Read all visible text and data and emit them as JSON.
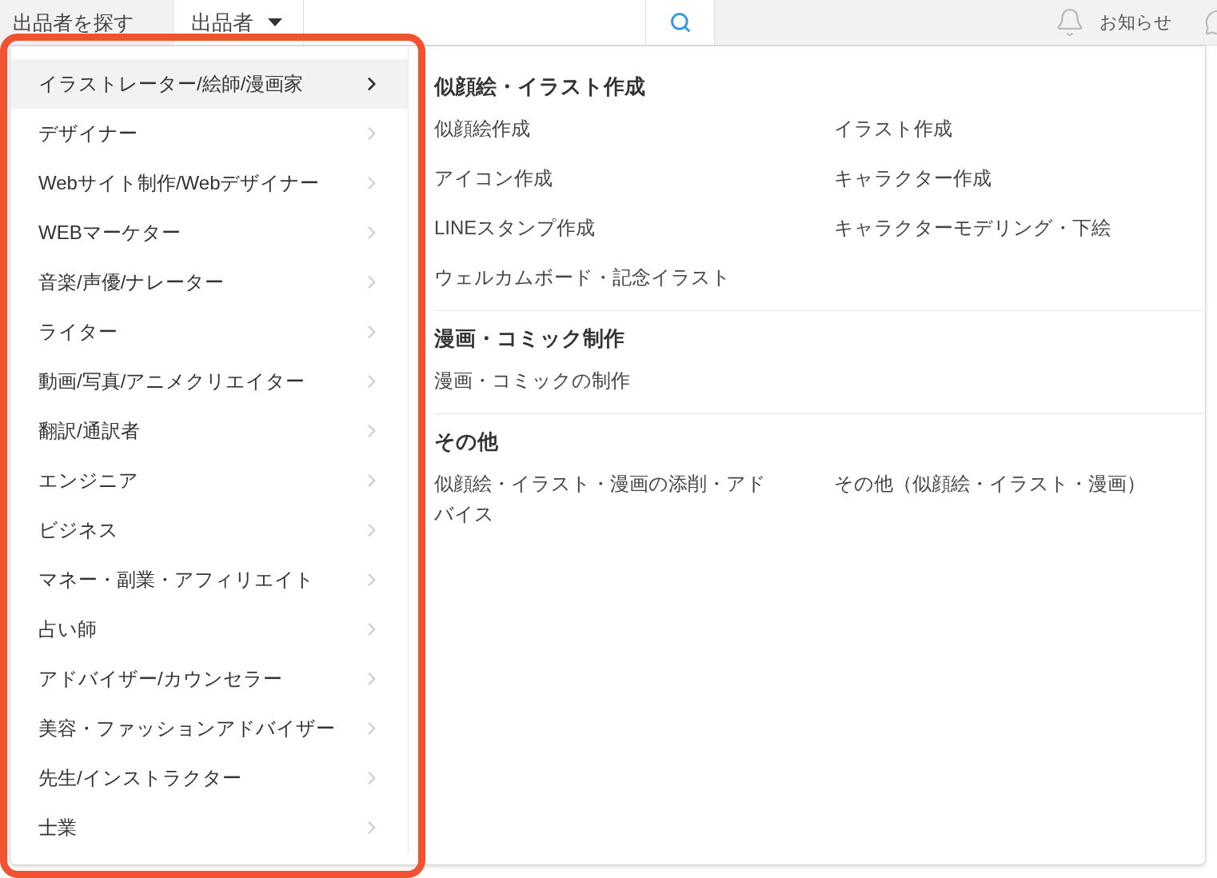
{
  "topbar": {
    "label": "出品者を探す",
    "type_select": {
      "value": "出品者"
    },
    "notifications": "お知らせ"
  },
  "menu": {
    "categories": [
      {
        "label": "イラストレーター/絵師/漫画家",
        "selected": true
      },
      {
        "label": "デザイナー",
        "selected": false
      },
      {
        "label": "Webサイト制作/Webデザイナー",
        "selected": false
      },
      {
        "label": "WEBマーケター",
        "selected": false
      },
      {
        "label": "音楽/声優/ナレーター",
        "selected": false
      },
      {
        "label": "ライター",
        "selected": false
      },
      {
        "label": "動画/写真/アニメクリエイター",
        "selected": false
      },
      {
        "label": "翻訳/通訳者",
        "selected": false
      },
      {
        "label": "エンジニア",
        "selected": false
      },
      {
        "label": "ビジネス",
        "selected": false
      },
      {
        "label": "マネー・副業・アフィリエイト",
        "selected": false
      },
      {
        "label": "占い師",
        "selected": false
      },
      {
        "label": "アドバイザー/カウンセラー",
        "selected": false
      },
      {
        "label": "美容・ファッションアドバイザー",
        "selected": false
      },
      {
        "label": "先生/インストラクター",
        "selected": false
      },
      {
        "label": "士業",
        "selected": false
      }
    ],
    "sections": [
      {
        "heading": "似顔絵・イラスト作成",
        "items": [
          "似顔絵作成",
          "イラスト作成",
          "アイコン作成",
          "キャラクター作成",
          "LINEスタンプ作成",
          "キャラクターモデリング・下絵",
          "ウェルカムボード・記念イラスト"
        ]
      },
      {
        "heading": "漫画・コミック制作",
        "items": [
          "漫画・コミックの制作"
        ]
      },
      {
        "heading": "その他",
        "items": [
          "似顔絵・イラスト・漫画の添削・アドバイス",
          "その他（似顔絵・イラスト・漫画）"
        ]
      }
    ]
  }
}
